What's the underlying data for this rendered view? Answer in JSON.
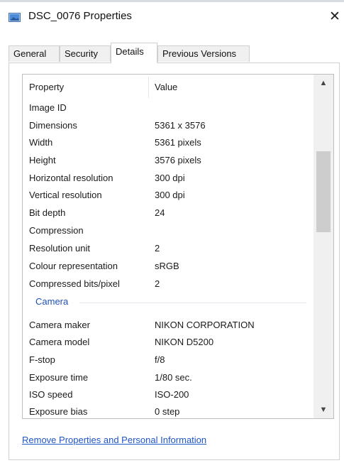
{
  "window": {
    "title": "DSC_0076 Properties",
    "close_glyph": "✕"
  },
  "tabs": [
    {
      "label": "General"
    },
    {
      "label": "Security"
    },
    {
      "label": "Details"
    },
    {
      "label": "Previous Versions"
    }
  ],
  "active_tab": "Details",
  "list": {
    "header": {
      "property": "Property",
      "value": "Value"
    },
    "rows": [
      {
        "property": "Image ID",
        "value": ""
      },
      {
        "property": "Dimensions",
        "value": "5361 x 3576"
      },
      {
        "property": "Width",
        "value": "5361 pixels"
      },
      {
        "property": "Height",
        "value": "3576 pixels"
      },
      {
        "property": "Horizontal resolution",
        "value": "300 dpi"
      },
      {
        "property": "Vertical resolution",
        "value": "300 dpi"
      },
      {
        "property": "Bit depth",
        "value": "24"
      },
      {
        "property": "Compression",
        "value": ""
      },
      {
        "property": "Resolution unit",
        "value": "2"
      },
      {
        "property": "Colour representation",
        "value": "sRGB"
      },
      {
        "property": "Compressed bits/pixel",
        "value": "2"
      }
    ],
    "camera_group": "Camera",
    "camera_rows": [
      {
        "property": "Camera maker",
        "value": "NIKON CORPORATION"
      },
      {
        "property": "Camera model",
        "value": "NIKON D5200"
      },
      {
        "property": "F-stop",
        "value": "f/8"
      },
      {
        "property": "Exposure time",
        "value": "1/80 sec."
      },
      {
        "property": "ISO speed",
        "value": "ISO-200"
      },
      {
        "property": "Exposure bias",
        "value": "0 step"
      }
    ]
  },
  "scrollbar": {
    "up_glyph": "▲",
    "down_glyph": "▼"
  },
  "link": {
    "remove_properties": "Remove Properties and Personal Information"
  },
  "colors": {
    "link": "#1f55c5",
    "group_heading": "#1f4fb5"
  },
  "icons": {
    "title": "image-file-icon"
  }
}
